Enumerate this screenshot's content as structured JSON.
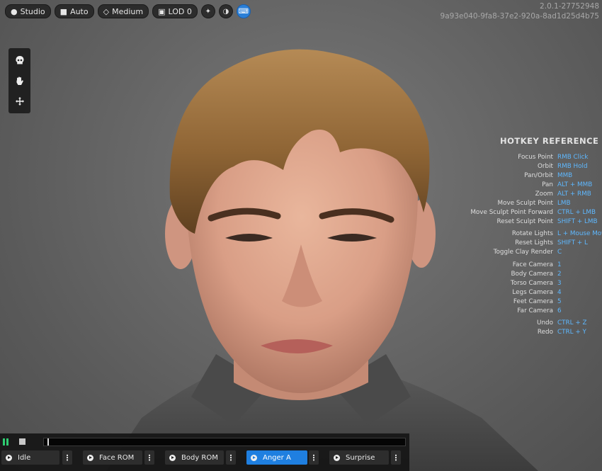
{
  "toolbar": {
    "studio_label": "Studio",
    "auto_label": "Auto",
    "quality_label": "Medium",
    "lod_label": "LOD 0"
  },
  "version": {
    "number": "2.0.1-27752948",
    "hash": "9a93e040-9fa8-37e2-920a-8ad1d25d4b75"
  },
  "hotkeys": {
    "title": "HOTKEY REFERENCE",
    "rows": [
      {
        "label": "Focus Point",
        "keys": "RMB Click"
      },
      {
        "label": "Orbit",
        "keys": "RMB Hold"
      },
      {
        "label": "Pan/Orbit",
        "keys": "MMB"
      },
      {
        "label": "Pan",
        "keys": "ALT + MMB"
      },
      {
        "label": "Zoom",
        "keys": "ALT + RMB"
      },
      {
        "label": "Move Sculpt Point",
        "keys": "LMB"
      },
      {
        "label": "Move Sculpt Point Forward",
        "keys": "CTRL + LMB"
      },
      {
        "label": "Reset Sculpt Point",
        "keys": "SHIFT + LMB"
      },
      {
        "label": "Rotate Lights",
        "keys": "L + Mouse Move"
      },
      {
        "label": "Reset Lights",
        "keys": "SHIFT + L"
      },
      {
        "label": "Toggle Clay Render",
        "keys": "C"
      },
      {
        "label": "Face Camera",
        "keys": "1"
      },
      {
        "label": "Body Camera",
        "keys": "2"
      },
      {
        "label": "Torso Camera",
        "keys": "3"
      },
      {
        "label": "Legs Camera",
        "keys": "4"
      },
      {
        "label": "Feet Camera",
        "keys": "5"
      },
      {
        "label": "Far Camera",
        "keys": "6"
      },
      {
        "label": "Undo",
        "keys": "CTRL + Z"
      },
      {
        "label": "Redo",
        "keys": "CTRL + Y"
      }
    ]
  },
  "animations": {
    "items": [
      {
        "label": "Idle"
      },
      {
        "label": "Face ROM"
      },
      {
        "label": "Body ROM"
      },
      {
        "label": "Anger A"
      },
      {
        "label": "Surprise"
      }
    ],
    "active": "Anger A"
  },
  "playback": {
    "state": "playing",
    "progress": 0.01
  },
  "colors": {
    "accent": "#1f7fe0",
    "hotkey_text": "#5eb8ff",
    "play_green": "#2ecc71"
  }
}
